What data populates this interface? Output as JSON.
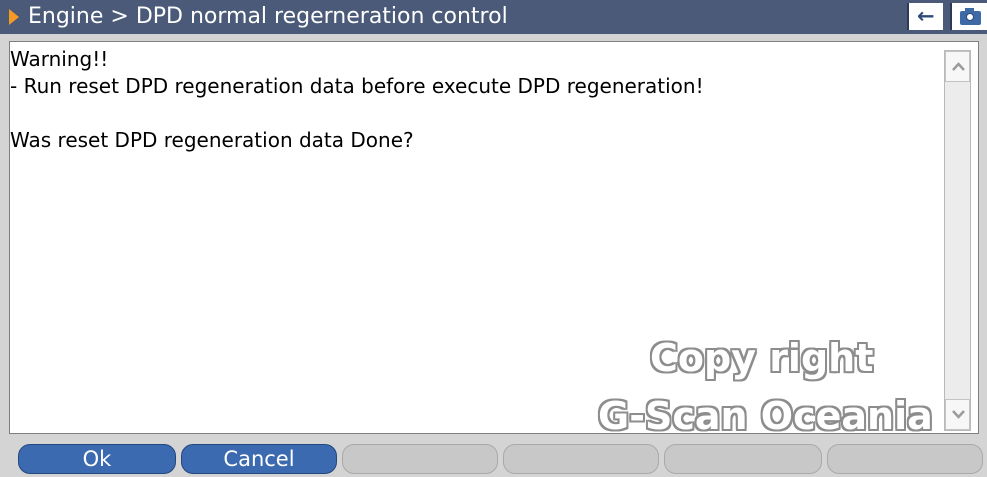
{
  "window": {
    "breadcrumb": "Engine > DPD normal regerneration control",
    "accent_color": "#f59a23",
    "titlebar_color": "#4a5a78",
    "buttons": [
      {
        "name": "back",
        "icon": "arrow-left-icon"
      },
      {
        "name": "camera",
        "icon": "camera-icon"
      }
    ]
  },
  "message": {
    "lines": [
      "Warning!!",
      "- Run reset DPD regeneration data before execute DPD regeneration!",
      "",
      "Was reset DPD regeneration data Done?"
    ]
  },
  "watermark": {
    "line1": "Copy right",
    "line2": "G-Scan Oceania"
  },
  "function_keys": [
    {
      "label": "Ok",
      "enabled": true
    },
    {
      "label": "Cancel",
      "enabled": true
    },
    {
      "label": "",
      "enabled": false
    },
    {
      "label": "",
      "enabled": false
    },
    {
      "label": "",
      "enabled": false
    },
    {
      "label": "",
      "enabled": false
    }
  ],
  "button_color": "#3b6ab0"
}
